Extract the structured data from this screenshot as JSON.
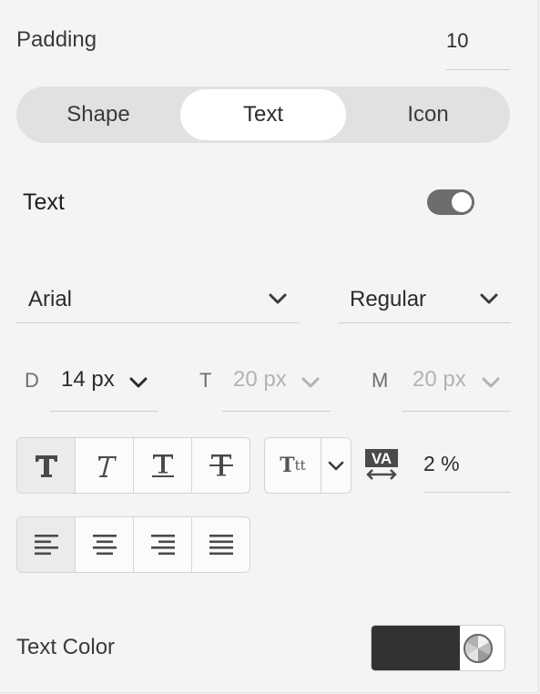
{
  "padding": {
    "label": "Padding",
    "value": "10"
  },
  "tabs": [
    {
      "label": "Shape",
      "selected": false
    },
    {
      "label": "Text",
      "selected": true
    },
    {
      "label": "Icon",
      "selected": false
    }
  ],
  "text_toggle": {
    "label": "Text",
    "enabled": true
  },
  "font": {
    "family": "Arial",
    "weight": "Regular"
  },
  "sizes": {
    "desktop": {
      "letter": "D",
      "value": "14 px"
    },
    "tablet": {
      "letter": "T",
      "value": "20 px"
    },
    "mobile": {
      "letter": "M",
      "value": "20 px"
    }
  },
  "style_buttons": [
    "bold-icon",
    "italic-icon",
    "underline-icon",
    "strikethrough-icon"
  ],
  "case_button": {
    "big": "T",
    "small": "tt"
  },
  "tracking": {
    "icon": "tracking-icon",
    "value": "2 %"
  },
  "align_buttons": [
    "align-left-icon",
    "align-center-icon",
    "align-right-icon",
    "align-justify-icon"
  ],
  "text_color": {
    "label": "Text Color",
    "color": "#323232"
  }
}
